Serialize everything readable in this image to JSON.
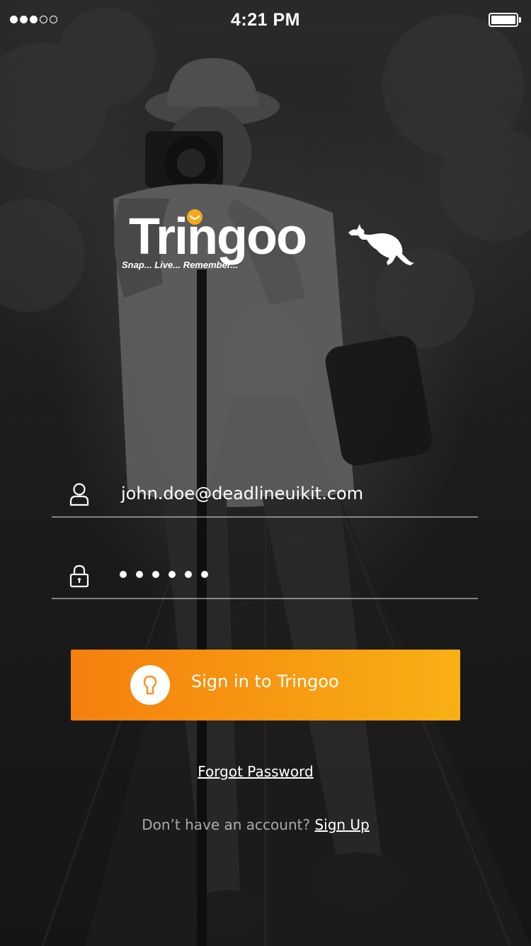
{
  "status_bar": {
    "signal_filled": 3,
    "signal_total": 5,
    "time": "4:21 PM",
    "battery_level": 1.0
  },
  "logo": {
    "wordmark": "Tringoo",
    "tagline": "Snap... Live... Remember...",
    "mascot_icon": "kangaroo-icon",
    "accent_color": "#f7a81b"
  },
  "form": {
    "email": {
      "icon": "user-icon",
      "value": "john.doe@deadlineuikit.com"
    },
    "password": {
      "icon": "lock-icon",
      "masked_length": 6
    },
    "signin_button": {
      "icon": "keyhole-icon",
      "label": "Sign in to Tringoo",
      "gradient_start": "#f57f0e",
      "gradient_end": "#f8b014"
    },
    "forgot_password": "Forgot Password",
    "signup_prompt": "Don’t have an account?",
    "signup_link": "Sign Up"
  }
}
